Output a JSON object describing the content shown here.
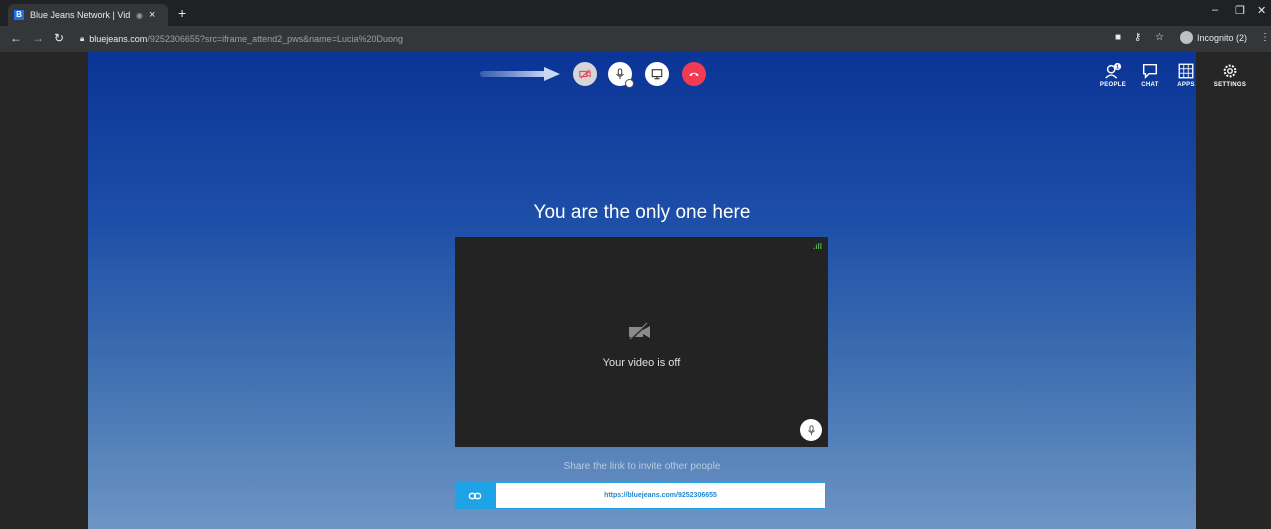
{
  "browser": {
    "tab_title": "Blue Jeans Network | Video C",
    "tab_close": "×",
    "new_tab": "+",
    "url_host": "bluejeans.com",
    "url_path": "/9252306655?src=iframe_attend2_pws&name=Lucia%20Duong",
    "profile_label": "Incognito (2)",
    "window_controls": {
      "minimize": "–",
      "maximize": "❐",
      "close": "✕"
    }
  },
  "toolbar": {
    "controls": [
      {
        "name": "video-toggle",
        "icon": "video-off-icon",
        "state": "off"
      },
      {
        "name": "mic-toggle",
        "icon": "mic-icon"
      },
      {
        "name": "share-screen",
        "icon": "screen-share-icon"
      },
      {
        "name": "hang-up",
        "icon": "hang-up-icon"
      }
    ]
  },
  "topnav": {
    "people": "PEOPLE",
    "chat": "CHAT",
    "apps": "APPS",
    "settings": "SETTINGS",
    "people_badge": "1"
  },
  "main": {
    "headline": "You are the only one here",
    "video_off_text": "Your video is off",
    "signal": ".ıll",
    "share_prompt": "Share the link to invite other people",
    "meeting_link": "https://bluejeans.com/9252306655"
  },
  "colors": {
    "stage_top": "#0a3496",
    "stage_bottom": "#6d95c4",
    "hangup": "#ef3c52",
    "link_accent": "#1ea3e6"
  }
}
